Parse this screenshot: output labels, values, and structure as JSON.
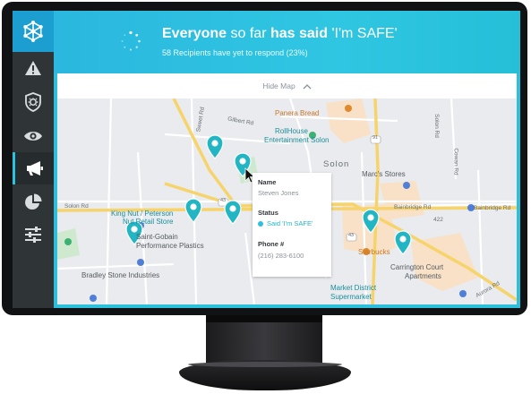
{
  "header": {
    "title_part1": "Everyone",
    "title_part2": "so far",
    "title_part3": "has said",
    "title_part4": "'I'm SAFE'",
    "subtitle": "58 Recipients have yet to respond (23%)"
  },
  "map": {
    "hide_label": "Hide Map",
    "labels": {
      "panera": "Panera Bread",
      "rollhouse1": "RollHouse",
      "rollhouse2": "Entertainment Solon",
      "solon": "Solon",
      "marcs": "Marc's Stores",
      "solon_rd": "Solon Rd",
      "bainbridge1": "Bainbridge Rd",
      "bainbridge2": "Bainbridge Rd",
      "kingnut1": "King Nut / Peterson",
      "kingnut2": "Nut Retail Store",
      "saintgobain1": "Saint-Gobain",
      "saintgobain2": "Performance Plastics",
      "starbucks": "Starbucks",
      "carrington1": "Carrington Court",
      "carrington2": "Apartments",
      "bradley": "Bradley Stone Industries",
      "market1": "Market District",
      "market2": "Supermarket",
      "aurora": "Aurora Rd",
      "r43a": "43",
      "r43b": "43",
      "r91": "91",
      "r422": "422",
      "sweet": "Sweet Rd",
      "gilbert": "Gilbert Rd",
      "rd_a": "Solon Rd",
      "rd_b": "Cowan Rd"
    }
  },
  "popup": {
    "name_label": "Name",
    "name_value": "Steven Jones",
    "status_label": "Status",
    "status_value": "Said 'I'm SAFE'",
    "phone_label": "Phone #",
    "phone_value": "(216) 283-6100"
  },
  "colors": {
    "accent": "#2cc0dd",
    "sidebar": "#2f3437",
    "logo_bg": "#1c9fd0",
    "map_bg": "#e9ebee",
    "road_major": "#f6d46b",
    "area_orange": "#f8e1c7"
  },
  "icons": [
    "network-logo-icon",
    "warning-icon",
    "shield-bug-icon",
    "eye-icon",
    "megaphone-icon",
    "pie-chart-icon",
    "sliders-icon",
    "spinner-icon",
    "chevron-up-icon",
    "map-pin-icon"
  ]
}
